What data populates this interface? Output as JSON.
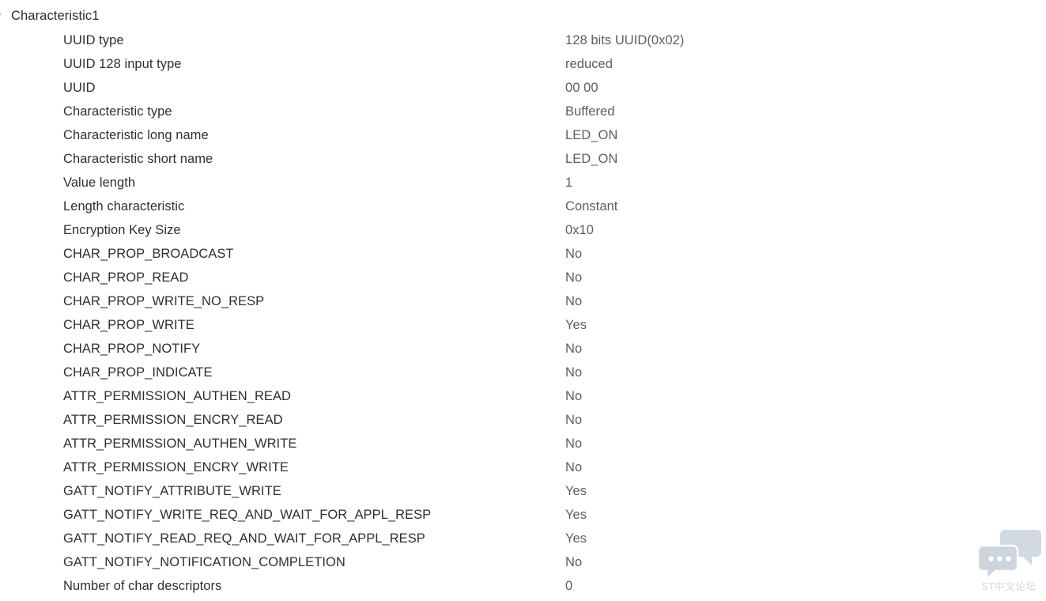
{
  "tree": {
    "root_label": "Characteristic1",
    "expander_icon": "chevron-expanded-icon",
    "expanded": true
  },
  "properties": [
    {
      "label": "UUID type",
      "value": "128 bits UUID(0x02)"
    },
    {
      "label": "UUID 128 input type",
      "value": "reduced"
    },
    {
      "label": "UUID",
      "value": "00 00"
    },
    {
      "label": "Characteristic type",
      "value": "Buffered"
    },
    {
      "label": "Characteristic long name",
      "value": "LED_ON"
    },
    {
      "label": "Characteristic short name",
      "value": "LED_ON"
    },
    {
      "label": "Value length",
      "value": "1"
    },
    {
      "label": "Length characteristic",
      "value": "Constant"
    },
    {
      "label": "Encryption Key Size",
      "value": "0x10"
    },
    {
      "label": "CHAR_PROP_BROADCAST",
      "value": "No"
    },
    {
      "label": "CHAR_PROP_READ",
      "value": "No"
    },
    {
      "label": "CHAR_PROP_WRITE_NO_RESP",
      "value": "No"
    },
    {
      "label": "CHAR_PROP_WRITE",
      "value": "Yes"
    },
    {
      "label": "CHAR_PROP_NOTIFY",
      "value": "No"
    },
    {
      "label": "CHAR_PROP_INDICATE",
      "value": "No"
    },
    {
      "label": "ATTR_PERMISSION_AUTHEN_READ",
      "value": "No"
    },
    {
      "label": "ATTR_PERMISSION_ENCRY_READ",
      "value": "No"
    },
    {
      "label": "ATTR_PERMISSION_AUTHEN_WRITE",
      "value": "No"
    },
    {
      "label": "ATTR_PERMISSION_ENCRY_WRITE",
      "value": "No"
    },
    {
      "label": "GATT_NOTIFY_ATTRIBUTE_WRITE",
      "value": "Yes"
    },
    {
      "label": "GATT_NOTIFY_WRITE_REQ_AND_WAIT_FOR_APPL_RESP",
      "value": "Yes"
    },
    {
      "label": "GATT_NOTIFY_READ_REQ_AND_WAIT_FOR_APPL_RESP",
      "value": "Yes"
    },
    {
      "label": "GATT_NOTIFY_NOTIFICATION_COMPLETION",
      "value": "No"
    },
    {
      "label": "Number of char descriptors",
      "value": "0"
    }
  ],
  "watermark": {
    "text": "ST中文论坛",
    "icon": "chat-bubbles-icon",
    "color": "#b8c0cc"
  },
  "colors": {
    "background": "#ffffff",
    "label_text": "#2f2f2f",
    "value_text": "#5a5f63",
    "root_text": "#2b2b2b",
    "expander": "#9a9a9a"
  }
}
